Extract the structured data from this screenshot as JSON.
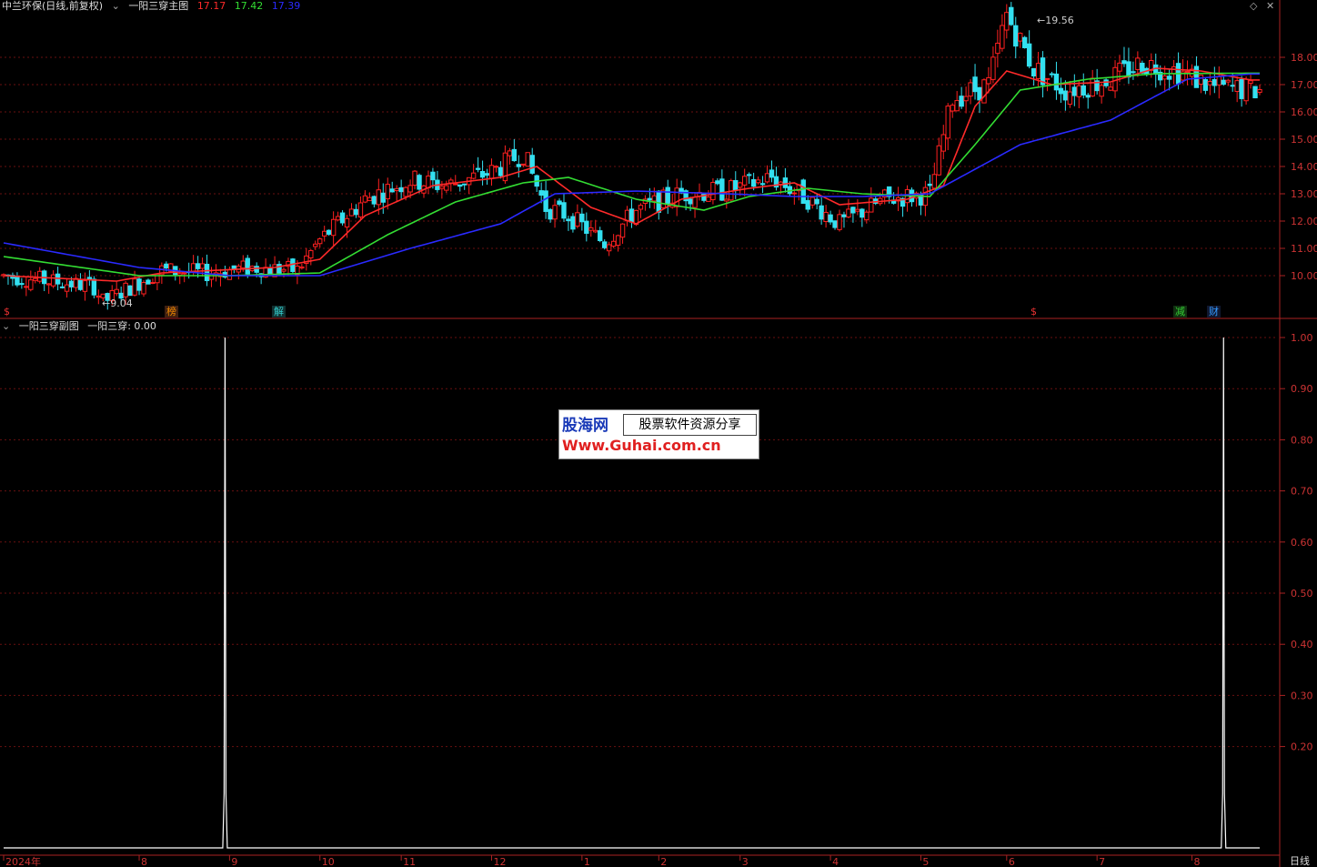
{
  "header": {
    "stock_name": "中兰环保(日线,前复权)",
    "main_indicator": "一阳三穿主图",
    "ma_values": [
      "17.17",
      "17.42",
      "17.39"
    ],
    "ma_colors": [
      "#ff2a2a",
      "#33dd33",
      "#2a2aff"
    ],
    "sub_indicator": "一阳三穿副图",
    "sub_value": "一阳三穿: 0.00"
  },
  "annotations": {
    "low": "9.04",
    "high": "19.56",
    "tags": [
      {
        "text": "$",
        "color": "#e33"
      },
      {
        "text": "榜",
        "color": "#c80"
      },
      {
        "text": "解",
        "color": "#3cc"
      },
      {
        "text": "$",
        "color": "#e33"
      },
      {
        "text": "减",
        "color": "#3c3"
      },
      {
        "text": "财",
        "color": "#39f"
      }
    ]
  },
  "footer": {
    "period": "日线"
  },
  "watermark": {
    "brand": "股海网",
    "slogan": "股票软件资源分享",
    "url": "Www.Guhai.com.cn"
  },
  "chart_data": [
    {
      "type": "candlestick",
      "title": "一阳三穿主图",
      "ylim": [
        9.0,
        20.0
      ],
      "y_ticks": [
        "18.00",
        "17.00",
        "16.00",
        "15.00",
        "14.00",
        "13.00",
        "12.00",
        "11.00",
        "10.00"
      ],
      "x_ticks": [
        "2024年",
        "8",
        "9",
        "10",
        "11",
        "12",
        "1",
        "2",
        "3",
        "4",
        "5",
        "6",
        "7",
        "8"
      ],
      "x_tick_days": [
        0,
        30,
        50,
        70,
        88,
        108,
        128,
        145,
        163,
        183,
        203,
        222,
        242,
        263
      ],
      "total_days": 278,
      "price_path": [
        [
          0,
          10.0
        ],
        [
          20,
          9.6
        ],
        [
          22,
          9.04
        ],
        [
          35,
          10.2
        ],
        [
          45,
          10.1
        ],
        [
          55,
          10.3
        ],
        [
          65,
          10.2
        ],
        [
          70,
          11.3
        ],
        [
          80,
          12.8
        ],
        [
          90,
          13.5
        ],
        [
          98,
          13.3
        ],
        [
          108,
          13.8
        ],
        [
          115,
          14.5
        ],
        [
          120,
          12.5
        ],
        [
          125,
          12.2
        ],
        [
          133,
          11.2
        ],
        [
          140,
          12.4
        ],
        [
          150,
          13.0
        ],
        [
          160,
          13.1
        ],
        [
          170,
          13.6
        ],
        [
          178,
          12.8
        ],
        [
          185,
          11.9
        ],
        [
          195,
          12.8
        ],
        [
          205,
          13.0
        ],
        [
          210,
          16.5
        ],
        [
          218,
          17.0
        ],
        [
          222,
          19.56
        ],
        [
          228,
          17.6
        ],
        [
          235,
          16.8
        ],
        [
          245,
          17.2
        ],
        [
          252,
          17.8
        ],
        [
          260,
          17.5
        ],
        [
          268,
          16.9
        ],
        [
          276,
          16.8
        ]
      ],
      "ma_series": [
        {
          "name": "MA1",
          "color": "#ff2a2a",
          "values": [
            [
              0,
              10.0
            ],
            [
              25,
              9.8
            ],
            [
              35,
              10.1
            ],
            [
              60,
              10.3
            ],
            [
              70,
              10.6
            ],
            [
              80,
              12.2
            ],
            [
              95,
              13.3
            ],
            [
              110,
              13.6
            ],
            [
              118,
              14.0
            ],
            [
              130,
              12.5
            ],
            [
              140,
              11.9
            ],
            [
              150,
              12.8
            ],
            [
              165,
              13.2
            ],
            [
              175,
              13.4
            ],
            [
              185,
              12.6
            ],
            [
              200,
              12.8
            ],
            [
              208,
              13.3
            ],
            [
              215,
              16.2
            ],
            [
              222,
              17.5
            ],
            [
              232,
              17.0
            ],
            [
              245,
              17.1
            ],
            [
              255,
              17.6
            ],
            [
              265,
              17.5
            ],
            [
              276,
              17.17
            ]
          ]
        },
        {
          "name": "MA2",
          "color": "#33dd33",
          "values": [
            [
              0,
              10.7
            ],
            [
              30,
              10.0
            ],
            [
              50,
              10.0
            ],
            [
              70,
              10.1
            ],
            [
              85,
              11.5
            ],
            [
              100,
              12.7
            ],
            [
              115,
              13.4
            ],
            [
              125,
              13.6
            ],
            [
              140,
              12.8
            ],
            [
              155,
              12.4
            ],
            [
              165,
              12.9
            ],
            [
              178,
              13.2
            ],
            [
              190,
              13.0
            ],
            [
              205,
              12.9
            ],
            [
              215,
              14.8
            ],
            [
              225,
              16.8
            ],
            [
              240,
              17.2
            ],
            [
              255,
              17.4
            ],
            [
              276,
              17.42
            ]
          ]
        },
        {
          "name": "MA3",
          "color": "#2a2aff",
          "values": [
            [
              0,
              11.2
            ],
            [
              30,
              10.3
            ],
            [
              50,
              10.0
            ],
            [
              70,
              10.0
            ],
            [
              90,
              11.0
            ],
            [
              110,
              11.9
            ],
            [
              122,
              13.0
            ],
            [
              140,
              13.1
            ],
            [
              160,
              13.0
            ],
            [
              175,
              12.9
            ],
            [
              190,
              12.9
            ],
            [
              205,
              13.0
            ],
            [
              225,
              14.8
            ],
            [
              245,
              15.7
            ],
            [
              262,
              17.2
            ],
            [
              276,
              17.39
            ]
          ]
        }
      ]
    },
    {
      "type": "line",
      "title": "一阳三穿副图",
      "ylim": [
        0.0,
        1.0
      ],
      "y_ticks": [
        "1.00",
        "0.90",
        "0.80",
        "0.70",
        "0.60",
        "0.50",
        "0.40",
        "0.30",
        "0.20"
      ],
      "series": [
        {
          "name": "一阳三穿",
          "color": "#ffffff",
          "spikes_at_days": [
            49,
            270
          ],
          "value": 1.0
        }
      ]
    }
  ]
}
